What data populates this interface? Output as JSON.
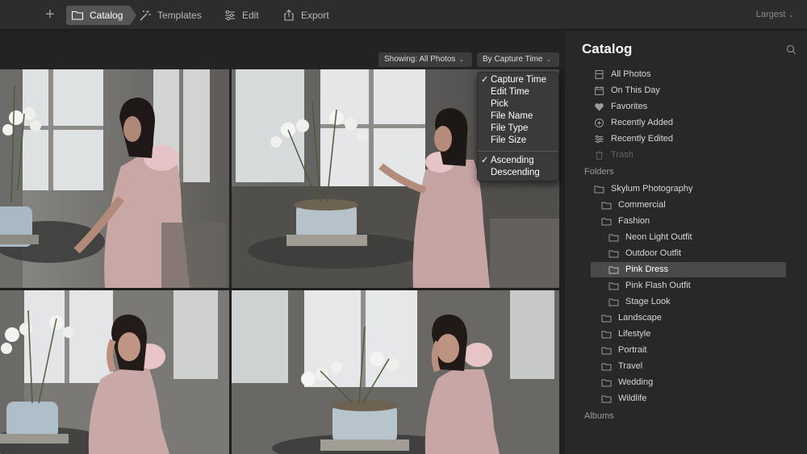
{
  "toolbar": {
    "add_label": "+",
    "catalog_label": "Catalog",
    "templates_label": "Templates",
    "edit_label": "Edit",
    "export_label": "Export",
    "size_label": "Largest"
  },
  "filter": {
    "showing_label": "Showing: All Photos",
    "sort_label": "By Capture Time"
  },
  "sort_menu": {
    "fields": [
      {
        "label": "Capture Time",
        "checked": true
      },
      {
        "label": "Edit Time",
        "checked": false
      },
      {
        "label": "Pick",
        "checked": false
      },
      {
        "label": "File Name",
        "checked": false
      },
      {
        "label": "File Type",
        "checked": false
      },
      {
        "label": "File Size",
        "checked": false
      }
    ],
    "order": [
      {
        "label": "Ascending",
        "checked": true
      },
      {
        "label": "Descending",
        "checked": false
      }
    ]
  },
  "panel": {
    "title": "Catalog",
    "library": [
      {
        "label": "All Photos",
        "icon": "photos-icon"
      },
      {
        "label": "On This Day",
        "icon": "calendar-icon"
      },
      {
        "label": "Favorites",
        "icon": "heart-icon"
      },
      {
        "label": "Recently Added",
        "icon": "plus-circle-icon"
      },
      {
        "label": "Recently Edited",
        "icon": "sliders-icon"
      },
      {
        "label": "Trash",
        "icon": "trash-icon"
      }
    ],
    "folders_label": "Folders",
    "folders": {
      "root": "Skylum Photography",
      "commercial": "Commercial",
      "fashion": "Fashion",
      "neon": "Neon Light Outfit",
      "outdoor": "Outdoor Outfit",
      "pink_dress": "Pink Dress",
      "pink_flash": "Pink Flash Outfit",
      "stage": "Stage Look",
      "landscape": "Landscape",
      "lifestyle": "Lifestyle",
      "portrait": "Portrait",
      "travel": "Travel",
      "wedding": "Wedding",
      "wildlife": "Wildlife"
    },
    "selected_folder": "Pink Dress",
    "albums_label": "Albums"
  }
}
